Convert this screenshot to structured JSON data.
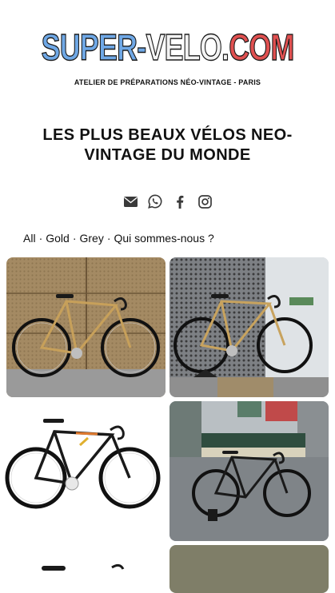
{
  "brand": {
    "logo_part1": "SUPER-",
    "logo_part2": "VELO.",
    "logo_part3": "COM",
    "tagline": "ATELIER DE PRÉPARATIONS NÉO-VINTAGE - PARIS",
    "colors": {
      "blue": "#6fa8e6",
      "white": "#f3f3f3",
      "red": "#e05050"
    }
  },
  "page": {
    "title": "LES PLUS BEAUX VÉLOS NEO-VINTAGE DU MONDE"
  },
  "socials": [
    {
      "icon": "envelope-icon"
    },
    {
      "icon": "whatsapp-icon"
    },
    {
      "icon": "facebook-icon"
    },
    {
      "icon": "instagram-icon"
    }
  ],
  "filters": {
    "items": [
      "All",
      "Gold",
      "Grey",
      "Qui sommes-nous ?"
    ],
    "separator": "·"
  },
  "gallery": [
    {
      "subject": "gold bike against perforated bronze wall"
    },
    {
      "subject": "gold bike on kickstand in front of metal wall"
    },
    {
      "subject": "black bike with orange stripes on white background"
    },
    {
      "subject": "black bike at Paris metro entrance"
    },
    {
      "subject": "black bike"
    },
    {
      "subject": "olive photo"
    }
  ]
}
